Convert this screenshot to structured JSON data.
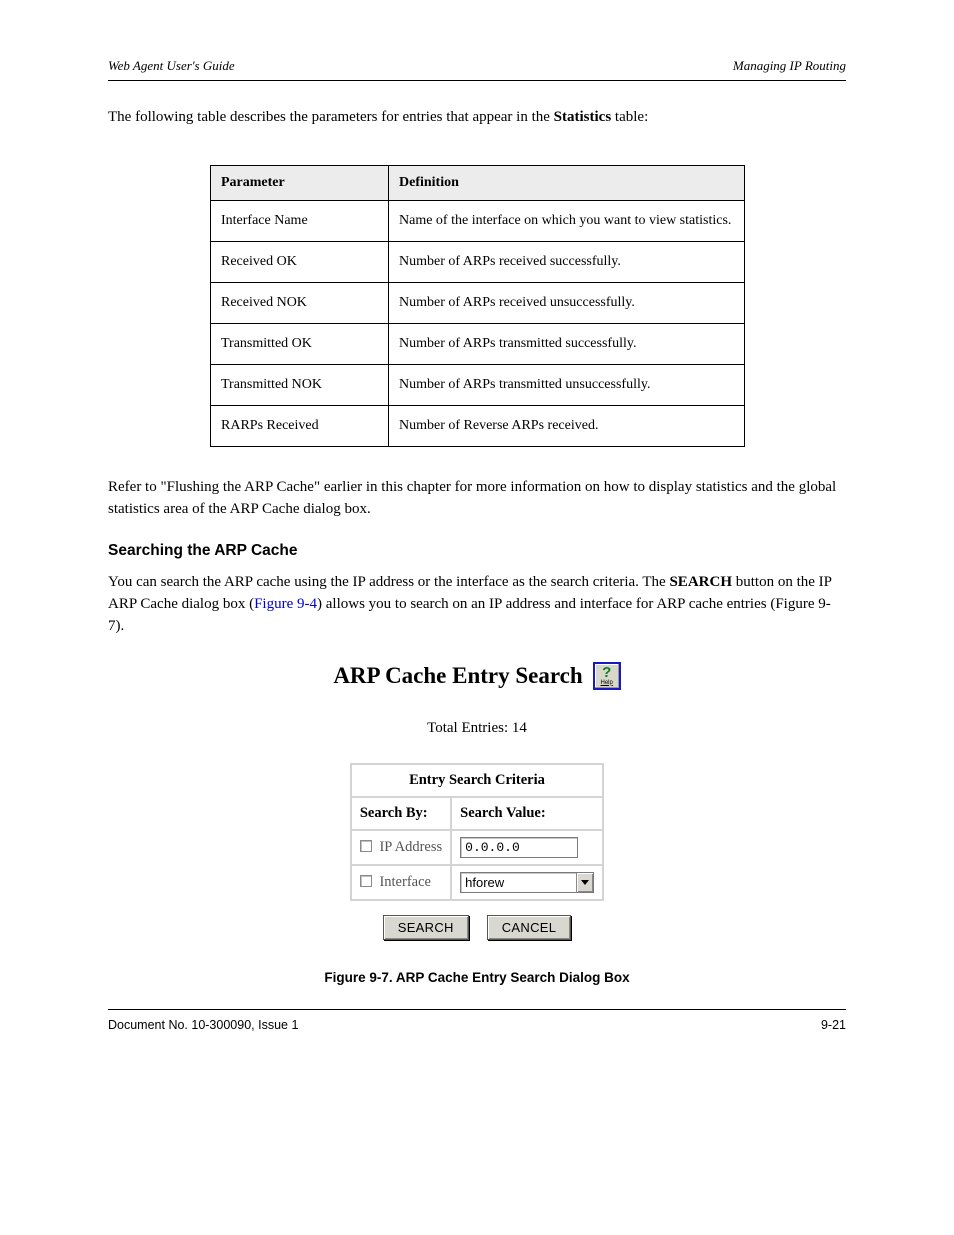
{
  "header": {
    "left": "Web Agent User's Guide",
    "right": "Managing IP Routing"
  },
  "intro": {
    "prefix": "The following table describes the parameters for entries that appear in the ",
    "bold": "Statistics",
    "suffix": " table:"
  },
  "table": {
    "headers": [
      "Parameter",
      "Definition"
    ],
    "rows": [
      [
        "Interface Name",
        "Name of the interface on which you want to view statistics."
      ],
      [
        "Received OK",
        "Number of ARPs received successfully."
      ],
      [
        "Received NOK",
        "Number of ARPs received unsuccessfully."
      ],
      [
        "Transmitted OK",
        "Number of ARPs transmitted successfully."
      ],
      [
        "Transmitted NOK",
        "Number of ARPs transmitted unsuccessfully."
      ],
      [
        "RARPs Received",
        "Number of Reverse ARPs received."
      ]
    ]
  },
  "subtext": "Refer to \"Flushing the ARP Cache\" earlier in this chapter for more information on how to display statistics and the global statistics area of the ARP Cache dialog box.",
  "section": {
    "title": "Searching the ARP Cache",
    "para_before": "You can search the ARP cache using the IP address or the interface as the search criteria. The ",
    "bold": "SEARCH",
    "para_mid": " button on the IP ARP Cache dialog box (",
    "figref": "Figure 9-4",
    "para_after": ") allows you to search on an IP address and interface for ARP cache entries (Figure 9-7)."
  },
  "figure": {
    "title": "ARP Cache Entry Search",
    "help_label": "Help",
    "total_label": "Total Entries:",
    "total_value": "14",
    "criteria_title": "Entry Search Criteria",
    "col1": "Search By:",
    "col2": "Search Value:",
    "row1_label": "IP Address",
    "row1_value": "0.0.0.0",
    "row2_label": "Interface",
    "row2_value": "hforew",
    "search_btn": "SEARCH",
    "cancel_btn": "CANCEL",
    "caption": "Figure 9-7.   ARP Cache Entry Search Dialog Box"
  },
  "footer": {
    "left": "Document No. 10-300090, Issue 1",
    "right": "9-21"
  }
}
